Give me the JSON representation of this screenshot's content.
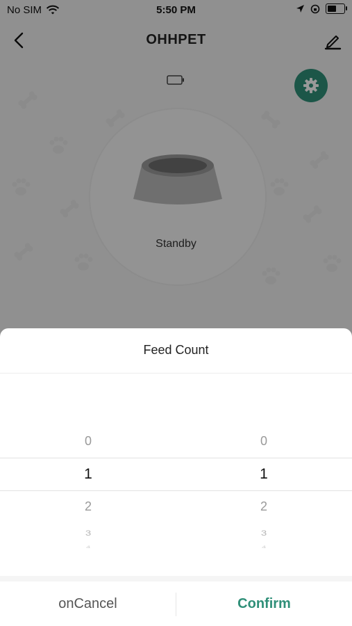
{
  "status_bar": {
    "carrier": "No SIM",
    "time": "5:50 PM",
    "battery_level": 0.45
  },
  "nav": {
    "title": "OHHPET"
  },
  "device": {
    "status": "Standby"
  },
  "picker_sheet": {
    "title": "Feed Count",
    "columns": [
      {
        "values": [
          "0",
          "1",
          "2",
          "3",
          "4"
        ],
        "selected": "1"
      },
      {
        "values": [
          "0",
          "1",
          "2",
          "3",
          "4"
        ],
        "selected": "1"
      }
    ],
    "cancel_label": "onCancel",
    "confirm_label": "Confirm"
  },
  "colors": {
    "accent": "#2f8f78",
    "background": "#f1f1f1",
    "sheet": "#ffffff"
  },
  "icons": [
    "back-chevron-icon",
    "edit-pencil-icon",
    "gear-icon",
    "battery-icon",
    "paw-icon",
    "bone-icon",
    "bowl-icon",
    "wifi-icon",
    "location-icon",
    "orientation-lock-icon"
  ]
}
